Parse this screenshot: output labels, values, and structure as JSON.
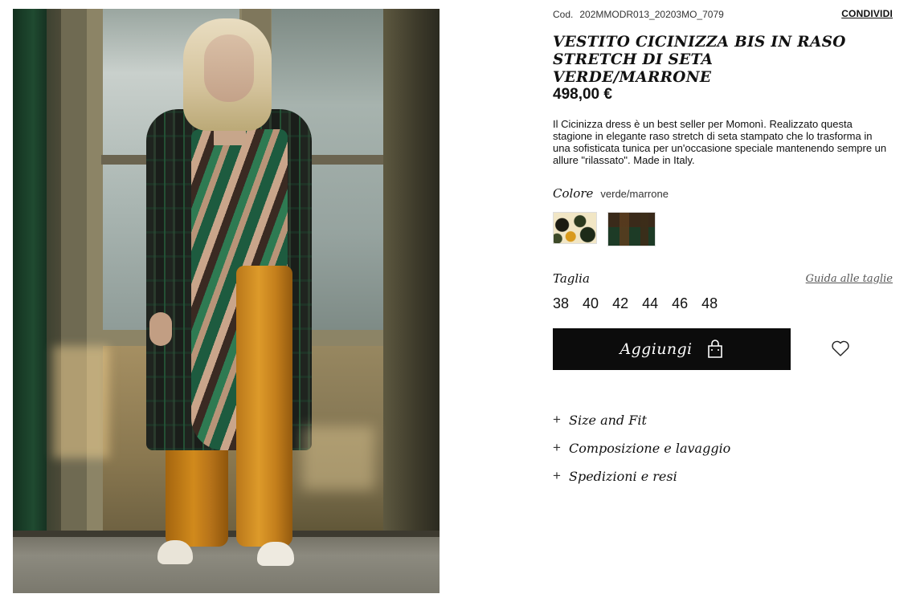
{
  "product": {
    "code_label": "Cod.",
    "code": "202MMODR013_20203MO_7079",
    "share_label": "CONDIVIDI",
    "title": "VESTITO CICINIZZA BIS IN RASO STRETCH DI SETA VERDE/MARRONE",
    "price": "498,00 €",
    "description": "Il Cicinizza dress è un best seller per Momonì. Realizzato questa stagione in elegante raso stretch di seta stampato che lo trasforma in una sofisticata tunica per un'occasione speciale mantenendo sempre un allure \"rilassato\". Made in Italy."
  },
  "color": {
    "label": "Colore",
    "value": "verde/marrone",
    "swatches": [
      {
        "name": "cream-floral"
      },
      {
        "name": "green-brown"
      }
    ]
  },
  "size": {
    "label": "Taglia",
    "guide_label": "Guida alle taglie",
    "options": [
      "38",
      "40",
      "42",
      "44",
      "46",
      "48"
    ]
  },
  "actions": {
    "add_label": "Aggiungi",
    "add_icon": "shopping-bag-icon",
    "wishlist_icon": "heart-icon"
  },
  "accordion": [
    {
      "label": "Size and Fit"
    },
    {
      "label": "Composizione e lavaggio"
    },
    {
      "label": "Spedizioni e resi"
    }
  ],
  "colors": {
    "button_bg": "#0c0c0c",
    "text": "#111111",
    "muted": "#555555"
  }
}
